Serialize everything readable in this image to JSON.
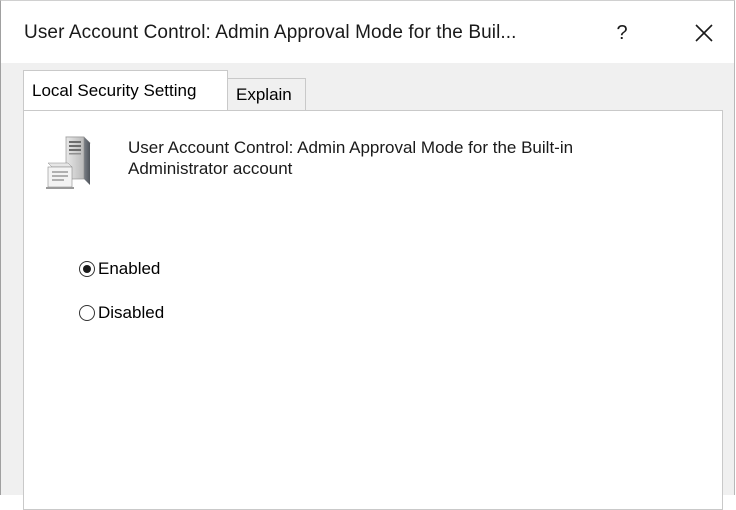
{
  "dialog": {
    "title": "User Account Control: Admin Approval Mode for the Buil...",
    "help_label": "?"
  },
  "tabs": [
    {
      "label": "Local Security Setting",
      "active": true
    },
    {
      "label": "Explain",
      "active": false
    }
  ],
  "policy": {
    "icon": "server-icon",
    "description": "User Account Control: Admin Approval Mode for the Built-in Administrator account"
  },
  "options": [
    {
      "label": "Enabled",
      "selected": true
    },
    {
      "label": "Disabled",
      "selected": false
    }
  ]
}
